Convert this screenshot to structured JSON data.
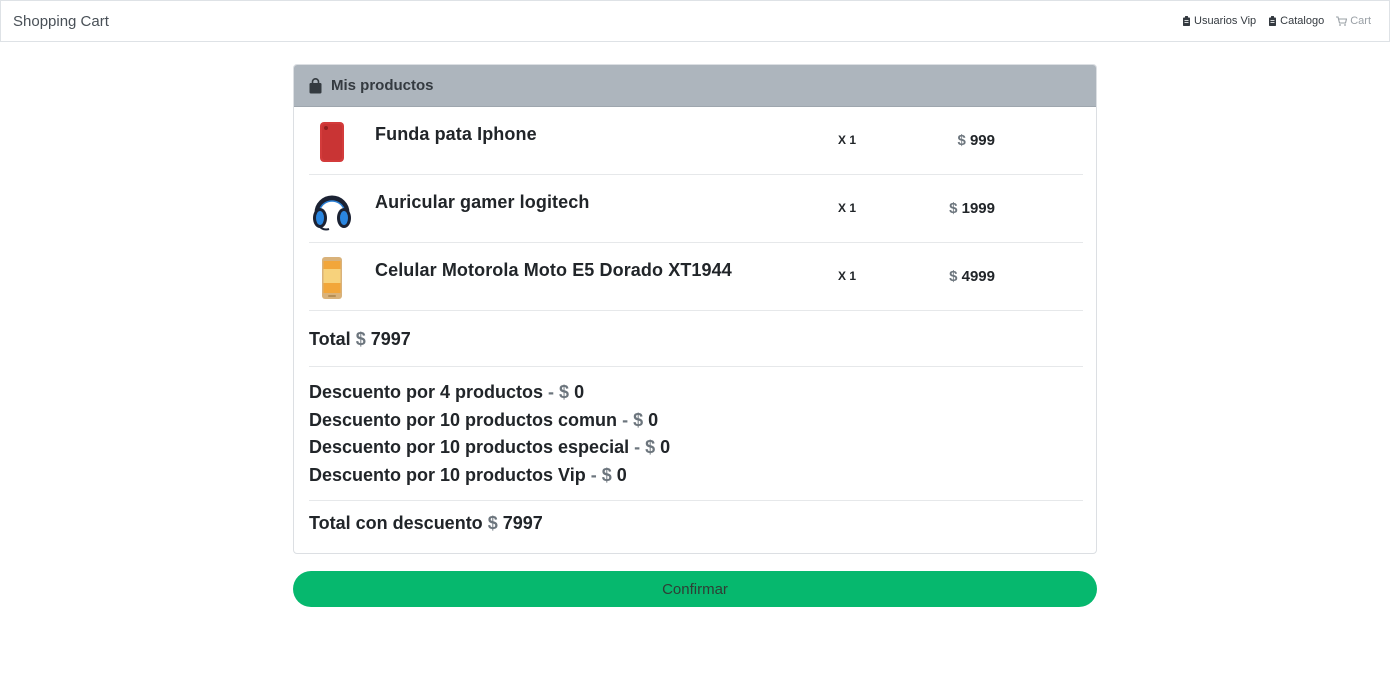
{
  "navbar": {
    "brand": "Shopping Cart",
    "links": [
      {
        "label": "Usuarios Vip",
        "icon": "clipboard-icon"
      },
      {
        "label": "Catalogo",
        "icon": "clipboard-icon"
      },
      {
        "label": "Cart",
        "icon": "cart-icon",
        "disabled": true
      }
    ]
  },
  "card": {
    "header_icon": "shopping-bag-icon",
    "title": "Mis productos"
  },
  "currency": "$",
  "items": [
    {
      "name": "Funda pata Iphone",
      "qty": "X 1",
      "price": "999",
      "thumb": "red-phone-case"
    },
    {
      "name": "Auricular gamer logitech",
      "qty": "X 1",
      "price": "1999",
      "thumb": "gaming-headset"
    },
    {
      "name": "Celular Motorola Moto E5 Dorado XT1944",
      "qty": "X 1",
      "price": "4999",
      "thumb": "gold-smartphone"
    }
  ],
  "total": {
    "label": "Total",
    "value": "7997"
  },
  "discounts": [
    {
      "label": "Descuento por 4 productos",
      "value": "0"
    },
    {
      "label": "Descuento por 10 productos comun",
      "value": "0"
    },
    {
      "label": "Descuento por 10 productos especial",
      "value": "0"
    },
    {
      "label": "Descuento por 10 productos Vip",
      "value": "0"
    }
  ],
  "total_discount": {
    "label": "Total con descuento",
    "value": "7997"
  },
  "confirm_label": "Confirmar",
  "colors": {
    "header_bg": "#adb5bd",
    "confirm_bg": "#06b86e",
    "muted": "#6c757d"
  }
}
